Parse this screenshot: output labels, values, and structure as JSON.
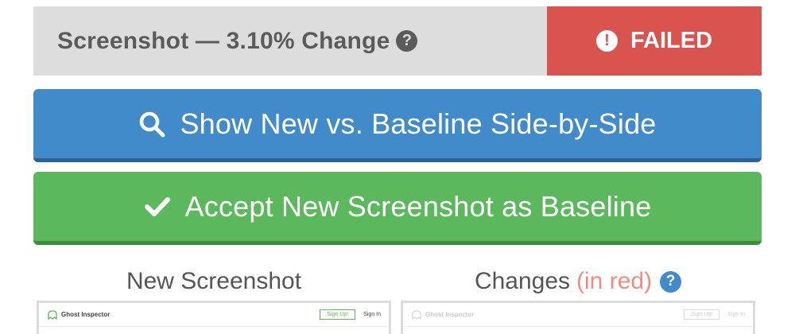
{
  "header": {
    "title": "Screenshot — 3.10% Change",
    "help_icon": "question-circle-icon",
    "status_label": "FAILED",
    "status_icon": "exclamation-circle-icon",
    "status_color": "#d9534f"
  },
  "actions": {
    "compare_label": "Show New vs. Baseline Side-by-Side",
    "compare_icon": "search-icon",
    "compare_color": "#428bca",
    "accept_label": "Accept New Screenshot as Baseline",
    "accept_icon": "checkmark-icon",
    "accept_color": "#5cb85c"
  },
  "columns": {
    "new_title": "New Screenshot",
    "changes_title": "Changes",
    "changes_note": "(in red)",
    "changes_help_icon": "question-circle-icon"
  },
  "thumbnails": {
    "logo_text": "Ghost Inspector",
    "signup_label": "Sign Up!",
    "signin_label": "Sign In"
  }
}
